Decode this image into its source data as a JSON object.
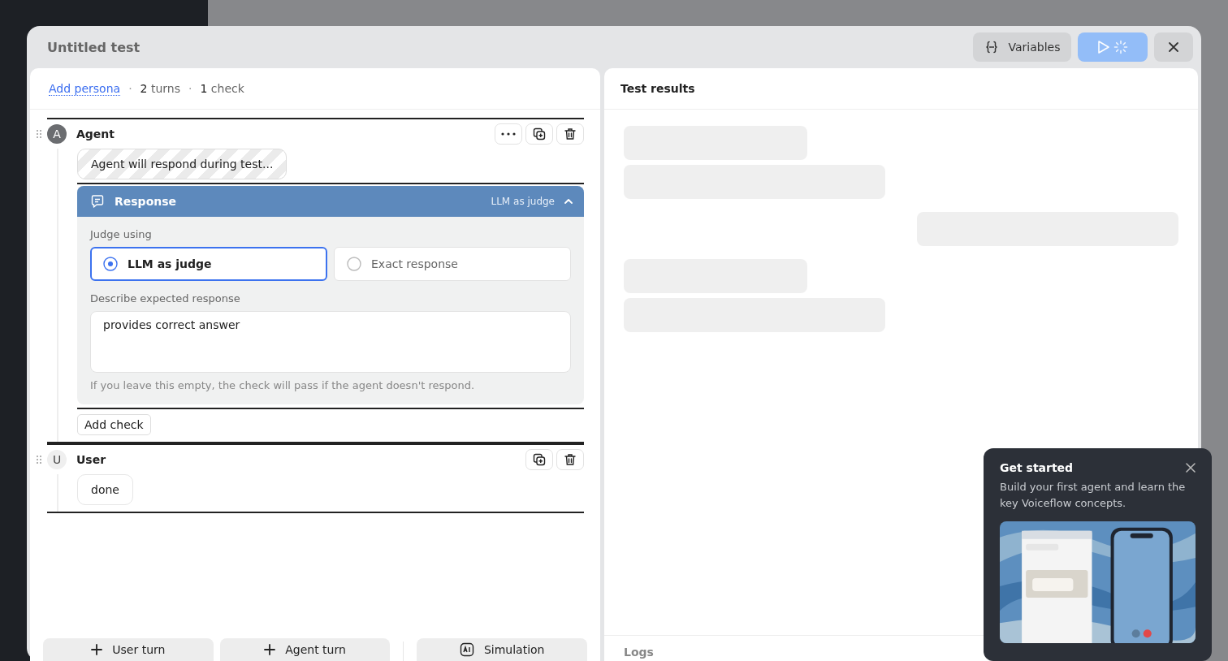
{
  "modal": {
    "title": "Untitled test",
    "variables_button": "Variables",
    "run_button": {
      "loading": true
    }
  },
  "editor": {
    "persona_link": "Add persona",
    "stats": [
      {
        "separator": "·",
        "text": "**2** turns"
      },
      {
        "separator": "·",
        "text": "**1** check"
      }
    ],
    "turns": [
      {
        "kind": "agent",
        "avatar": "A",
        "role": "Agent",
        "message": "Agent will respond during test...",
        "message_pending": true,
        "actions": [
          {
            "kind": "more"
          },
          {
            "kind": "duplicate"
          },
          {
            "kind": "delete"
          }
        ],
        "check": {
          "title": "Response",
          "mode": "LLM as judge",
          "expanded": true,
          "judge_label": "Judge using",
          "options": [
            {
              "label": "LLM as judge",
              "selected": true
            },
            {
              "label": "Exact response",
              "selected": false
            }
          ],
          "describe_label": "Describe expected response",
          "value": "provides correct answer",
          "hint": "If you leave this empty, the check will pass if the agent doesn't respond."
        },
        "add_check": "Add check"
      },
      {
        "kind": "user",
        "avatar": "U",
        "role": "User",
        "message": "done",
        "message_pending": false,
        "actions": [
          {
            "kind": "duplicate"
          },
          {
            "kind": "delete"
          }
        ]
      }
    ],
    "footer_buttons": [
      {
        "kind": "add",
        "label": "User turn"
      },
      {
        "kind": "add",
        "label": "Agent turn"
      },
      {
        "kind": "ai",
        "label": "Simulation"
      }
    ]
  },
  "results": {
    "title": "Test results",
    "skeleton": [
      {
        "kind": "short"
      },
      {
        "kind": "long"
      },
      {
        "kind": "reply"
      },
      {
        "kind": "short"
      },
      {
        "kind": "long"
      }
    ],
    "logs_title": "Logs"
  },
  "popover": {
    "title": "Get started",
    "text": "Build your first agent and learn the key Voiceflow concepts."
  }
}
